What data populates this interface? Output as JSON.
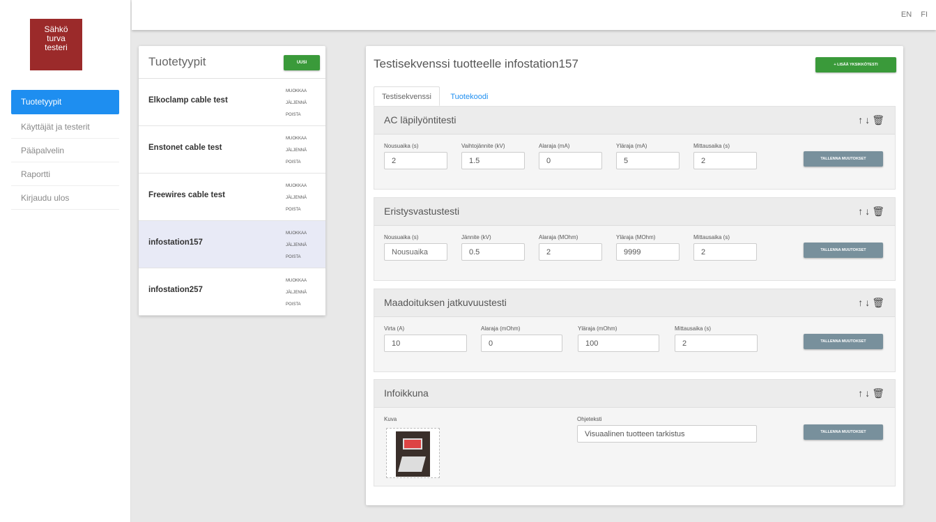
{
  "logo": {
    "line1": "Sähkö",
    "line2": "turva",
    "line3": "testeri"
  },
  "sidebar": {
    "items": [
      {
        "label": "Tuotetyypit",
        "active": true
      },
      {
        "label": "Käyttäjät ja testerit"
      },
      {
        "label": "Pääpalvelin"
      },
      {
        "label": "Raportti"
      },
      {
        "label": "Kirjaudu ulos"
      }
    ]
  },
  "header": {
    "lang_en": "EN",
    "lang_fi": "FI"
  },
  "products": {
    "title": "Tuotetyypit",
    "new_label": "UUSI",
    "edit_label": "MUOKKAA",
    "clone_label": "JÄLJENNÄ",
    "delete_label": "POISTA",
    "items": [
      {
        "name": "Elkoclamp cable test"
      },
      {
        "name": "Enstonet cable test"
      },
      {
        "name": "Freewires cable test"
      },
      {
        "name": "infostation157",
        "selected": true
      },
      {
        "name": "infostation257"
      }
    ]
  },
  "sequence": {
    "title": "Testisekvenssi tuotteelle infostation157",
    "add_label": "+ LISÄÄ YKSIKKÖTESTI",
    "tabs": [
      "Testisekvenssi",
      "Tuotekoodi"
    ],
    "save_label": "TALLENNA MUUTOKSET",
    "icons": {
      "up": "↑",
      "down": "↓",
      "trash": "🗑"
    },
    "sections": [
      {
        "title": "AC läpilyöntitesti",
        "fields": [
          {
            "label": "Nousuaika (s)",
            "value": "2"
          },
          {
            "label": "Vaihtojännite (kV)",
            "value": "1.5"
          },
          {
            "label": "Alaraja (mA)",
            "value": "0"
          },
          {
            "label": "Yläraja (mA)",
            "value": "5"
          },
          {
            "label": "Mittausaika (s)",
            "value": "2"
          }
        ]
      },
      {
        "title": "Eristysvastustesti",
        "fields": [
          {
            "label": "Nousuaika (s)",
            "value": "",
            "placeholder": "Nousuaika"
          },
          {
            "label": "Jännite (kV)",
            "value": "0.5"
          },
          {
            "label": "Alaraja (MOhm)",
            "value": "2"
          },
          {
            "label": "Yläraja (MOhm)",
            "value": "9999"
          },
          {
            "label": "Mittausaika (s)",
            "value": "2"
          }
        ]
      },
      {
        "title": "Maadoituksen jatkuvuustesti",
        "fields": [
          {
            "label": "Virta (A)",
            "value": "10"
          },
          {
            "label": "Alaraja (mOhm)",
            "value": "0"
          },
          {
            "label": "Yläraja (mOhm)",
            "value": "100"
          },
          {
            "label": "Mittausaika (s)",
            "value": "2"
          }
        ]
      },
      {
        "title": "Infoikkuna",
        "image_label": "Kuva",
        "text_label": "Ohjeteksti",
        "text_value": "Visuaalinen tuotteen tarkistus"
      }
    ]
  }
}
